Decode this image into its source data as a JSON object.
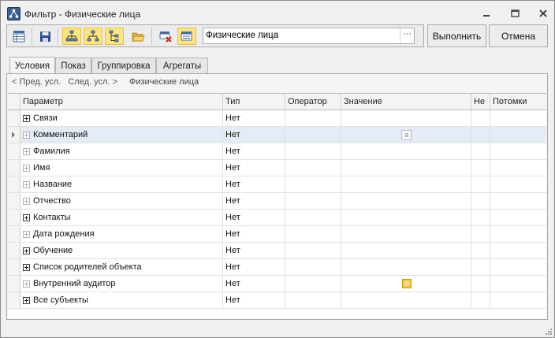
{
  "window": {
    "title": "Фильтр - Физические лица",
    "controls": {
      "minimize": "minimize",
      "maximize": "maximize",
      "close": "close"
    }
  },
  "toolbar": {
    "buttons": [
      {
        "icon": "grid-settings-icon",
        "active": false
      },
      {
        "icon": "save-icon",
        "active": false
      },
      {
        "icon": "tree-add-icon",
        "active": true
      },
      {
        "icon": "tree-add-child-icon",
        "active": true
      },
      {
        "icon": "tree-hierarchy-icon",
        "active": true
      },
      {
        "icon": "open-folder-icon",
        "active": false
      },
      {
        "icon": "delete-condition-icon",
        "active": false
      },
      {
        "icon": "apply-condition-icon",
        "active": true
      }
    ],
    "filter_value": "Физические лица",
    "filter_button": "···",
    "execute_label": "Выполнить",
    "cancel_label": "Отмена"
  },
  "tabs": [
    {
      "label": "Условия",
      "active": true
    },
    {
      "label": "Показ",
      "active": false
    },
    {
      "label": "Группировка",
      "active": false
    },
    {
      "label": "Агрегаты",
      "active": false
    }
  ],
  "breadcrumb": {
    "prev": "< Пред. усл.",
    "next": "След. усл. >",
    "current": "Физические лица"
  },
  "grid": {
    "columns": [
      "Параметр",
      "Тип",
      "Оператор",
      "Значение",
      "Не",
      "Потомки"
    ],
    "rows": [
      {
        "param": "Связи",
        "type": "Нет",
        "expander": "strong",
        "selected": false,
        "value_icon": ""
      },
      {
        "param": "Комментарий",
        "type": "Нет",
        "expander": "dim",
        "selected": true,
        "value_icon": "text-value-icon"
      },
      {
        "param": "Фамилия",
        "type": "Нет",
        "expander": "dim",
        "selected": false,
        "value_icon": ""
      },
      {
        "param": "Имя",
        "type": "Нет",
        "expander": "dim",
        "selected": false,
        "value_icon": ""
      },
      {
        "param": "Название",
        "type": "Нет",
        "expander": "dim",
        "selected": false,
        "value_icon": ""
      },
      {
        "param": "Отчество",
        "type": "Нет",
        "expander": "dim",
        "selected": false,
        "value_icon": ""
      },
      {
        "param": "Контакты",
        "type": "Нет",
        "expander": "strong",
        "selected": false,
        "value_icon": ""
      },
      {
        "param": "Дата рождения",
        "type": "Нет",
        "expander": "dim",
        "selected": false,
        "value_icon": ""
      },
      {
        "param": "Обучение",
        "type": "Нет",
        "expander": "strong",
        "selected": false,
        "value_icon": ""
      },
      {
        "param": "Список родителей объекта",
        "type": "Нет",
        "expander": "strong",
        "selected": false,
        "value_icon": ""
      },
      {
        "param": "Внутренний аудитор",
        "type": "Нет",
        "expander": "dim",
        "selected": false,
        "value_icon": "checkbox-value-icon"
      },
      {
        "param": "Все субъекты",
        "type": "Нет",
        "expander": "strong",
        "selected": false,
        "value_icon": ""
      }
    ]
  },
  "colors": {
    "selected_row": "#e3ecf7",
    "active_tool": "#fde47c",
    "window_bg": "#f0f0f0"
  }
}
